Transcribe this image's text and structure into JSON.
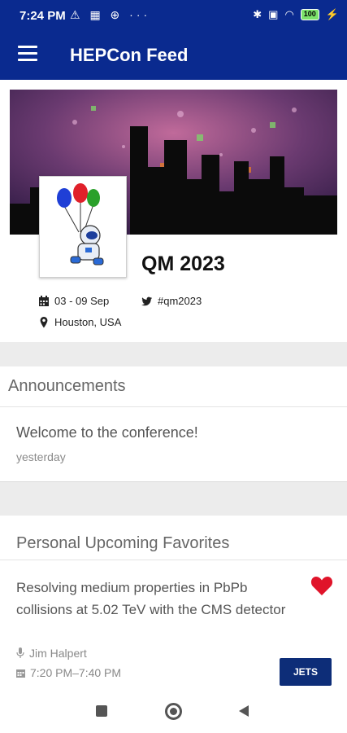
{
  "status_bar": {
    "time": "7:24 PM",
    "left_icons": "⚠ ▦ ⊕ ···",
    "battery": "100"
  },
  "app_bar": {
    "title": "HEPCon Feed"
  },
  "conference": {
    "name": "QM 2023",
    "dates": "03 - 09 Sep",
    "hashtag": "#qm2023",
    "location": "Houston, USA"
  },
  "announcements": {
    "header": "Announcements",
    "items": [
      {
        "title": "Welcome to the conference!",
        "time": "yesterday"
      }
    ]
  },
  "favorites": {
    "header": "Personal Upcoming Favorites",
    "items": [
      {
        "title": "Resolving medium properties in PbPb collisions at 5.02 TeV with the CMS detector",
        "speaker": "Jim Halpert",
        "time": "7:20 PM–7:40 PM",
        "tag": "JETS"
      }
    ]
  },
  "colors": {
    "primary": "#0a2a8f",
    "tag": "#0d2d78",
    "heart": "#e0142a"
  },
  "icons": [
    "menu-icon",
    "calendar-icon",
    "twitter-icon",
    "location-pin-icon",
    "heart-icon",
    "microphone-icon",
    "nav-recents-icon",
    "nav-home-icon",
    "nav-back-icon"
  ]
}
